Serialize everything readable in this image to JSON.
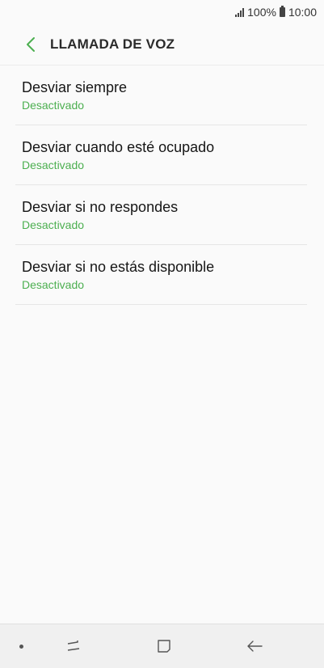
{
  "status_bar": {
    "battery_text": "100%",
    "time": "10:00"
  },
  "header": {
    "title": "LLAMADA DE VOZ",
    "back_icon": "chevron-left-icon"
  },
  "list": {
    "items": [
      {
        "title": "Desviar siempre",
        "status": "Desactivado"
      },
      {
        "title": "Desviar cuando esté ocupado",
        "status": "Desactivado"
      },
      {
        "title": "Desviar si no respondes",
        "status": "Desactivado"
      },
      {
        "title": "Desviar si no estás disponible",
        "status": "Desactivado"
      }
    ]
  },
  "nav_bar": {
    "icons": [
      "recent-apps-icon",
      "home-icon",
      "back-arrow-icon"
    ]
  },
  "colors": {
    "accent": "#4caf50",
    "background": "#fafafa"
  }
}
